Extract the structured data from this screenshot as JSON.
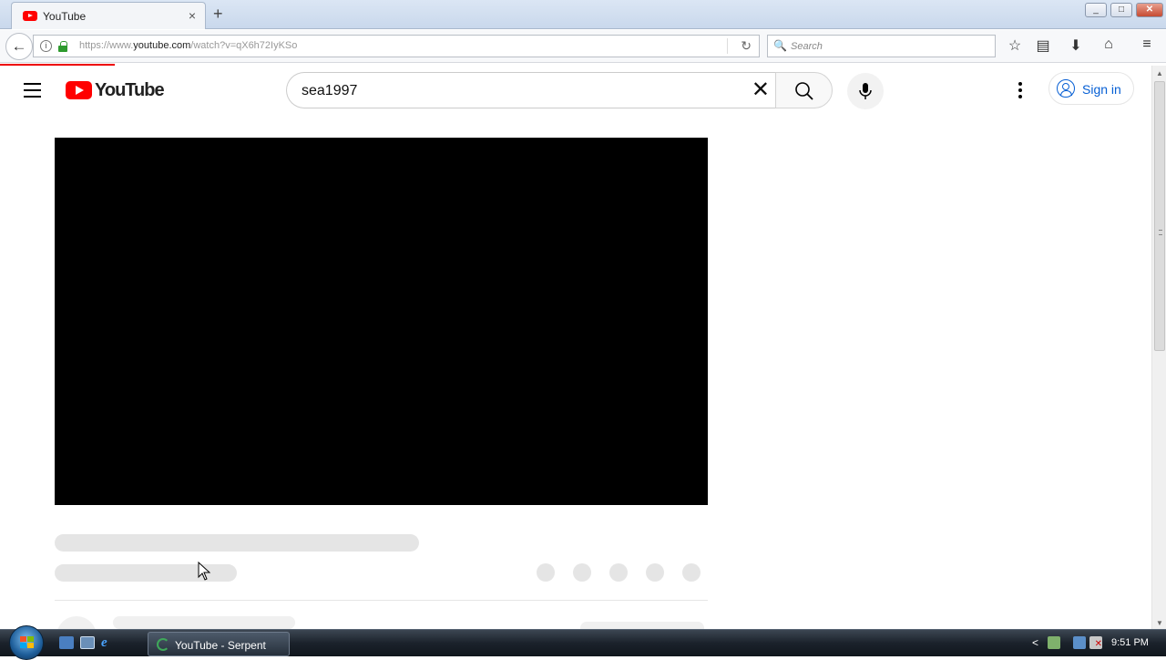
{
  "browser": {
    "tab_title": "YouTube",
    "tab_close": "×",
    "new_tab": "+",
    "url_prefix": "https://www.",
    "url_domain": "youtube.com",
    "url_path": "/watch?v=qX6h72IyKSo",
    "search_placeholder": "Search",
    "window_controls": {
      "minimize": "▭",
      "maximize": "▣",
      "close": "✕"
    }
  },
  "youtube": {
    "logo_text": "YouTube",
    "search_query": "sea1997",
    "clear_glyph": "✕",
    "signin_label": "Sign in",
    "brand_color": "#ff0000",
    "link_color": "#065fd4"
  },
  "taskbar": {
    "task_label": "YouTube - Serpent",
    "tray_arrow": "<",
    "clock": "9:51 PM"
  },
  "icons": {
    "back": "back-arrow-icon",
    "info": "info-icon",
    "lock": "lock-icon",
    "reload": "reload-icon",
    "bookmark_star": "star-icon",
    "reader": "reader-icon",
    "download": "download-icon",
    "home": "home-icon",
    "menu": "hamburger-menu-icon",
    "search": "magnifier-icon",
    "mic": "microphone-icon",
    "more": "vertical-dots-icon",
    "user": "user-circle-icon"
  }
}
